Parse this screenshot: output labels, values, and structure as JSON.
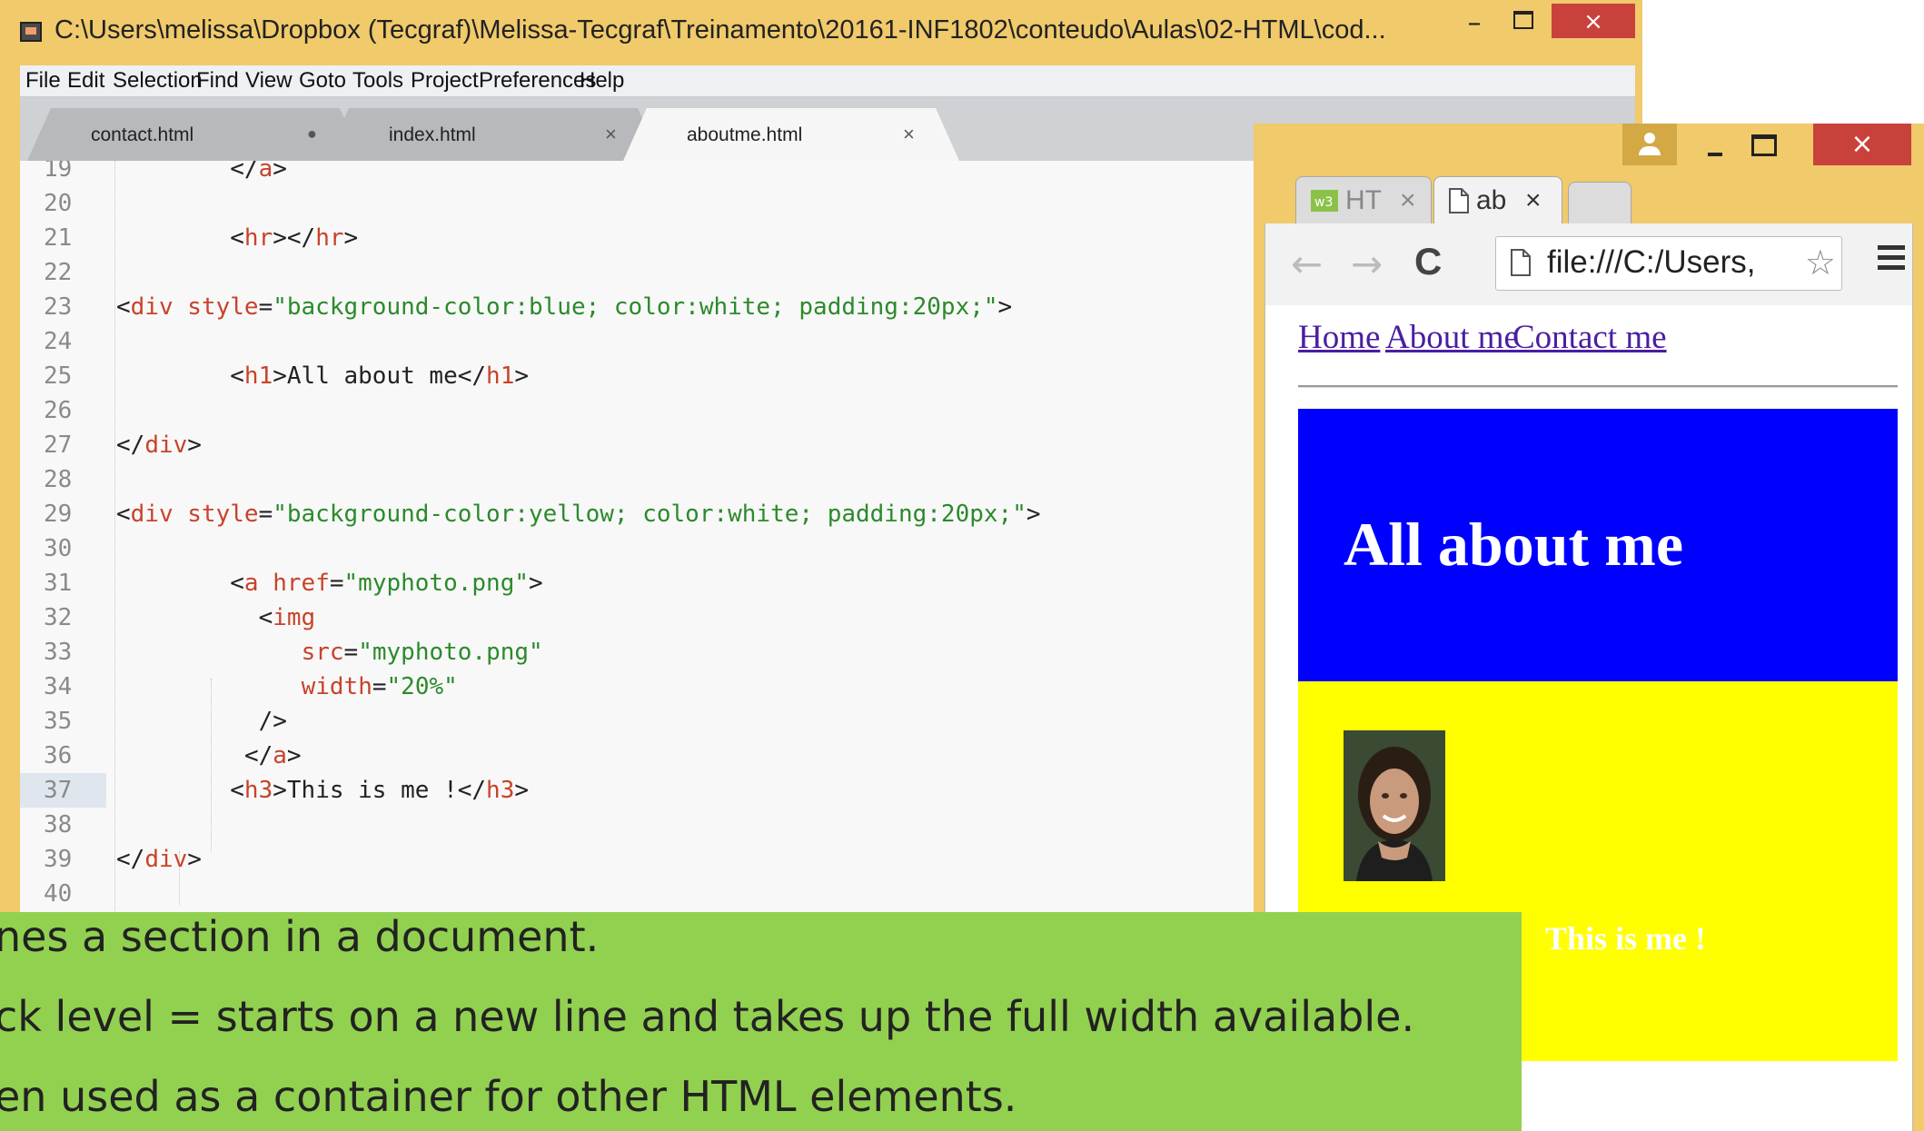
{
  "editor": {
    "title": "C:\\Users\\melissa\\Dropbox (Tecgraf)\\Melissa-Tecgraf\\Treinamento\\20161-INF1802\\conteudo\\Aulas\\02-HTML\\cod...",
    "window_controls": {
      "minimize": "–",
      "close": "×"
    },
    "menu": [
      "File",
      "Edit",
      "Selection",
      "Find",
      "View",
      "Goto",
      "Tools",
      "Project",
      "Preferences",
      "Help"
    ],
    "tabs": [
      {
        "label": "contact.html",
        "marker": "●"
      },
      {
        "label": "index.html",
        "marker": "×"
      },
      {
        "label": "aboutme.html",
        "marker": "×",
        "active": true
      }
    ],
    "current_line": "37",
    "lines": [
      {
        "n": "19",
        "indent": 8,
        "parts": [
          [
            "p",
            "</"
          ],
          [
            "t",
            "a"
          ],
          [
            "p",
            ">"
          ]
        ]
      },
      {
        "n": "20",
        "indent": 0,
        "parts": []
      },
      {
        "n": "21",
        "indent": 8,
        "parts": [
          [
            "p",
            "<"
          ],
          [
            "t",
            "hr"
          ],
          [
            "p",
            "></"
          ],
          [
            "t",
            "hr"
          ],
          [
            "p",
            ">"
          ]
        ]
      },
      {
        "n": "22",
        "indent": 0,
        "parts": []
      },
      {
        "n": "23",
        "indent": 0,
        "parts": [
          [
            "p",
            "<"
          ],
          [
            "t",
            "div"
          ],
          [
            "p",
            " "
          ],
          [
            "a",
            "style"
          ],
          [
            "p",
            "="
          ],
          [
            "s",
            "\"background-color:blue; color:white; padding:20px;\""
          ],
          [
            "p",
            ">"
          ]
        ]
      },
      {
        "n": "24",
        "indent": 0,
        "parts": []
      },
      {
        "n": "25",
        "indent": 8,
        "parts": [
          [
            "p",
            "<"
          ],
          [
            "t",
            "h1"
          ],
          [
            "p",
            ">All about me</"
          ],
          [
            "t",
            "h1"
          ],
          [
            "p",
            ">"
          ]
        ]
      },
      {
        "n": "26",
        "indent": 0,
        "parts": []
      },
      {
        "n": "27",
        "indent": 0,
        "parts": [
          [
            "p",
            "</"
          ],
          [
            "t",
            "div"
          ],
          [
            "p",
            ">"
          ]
        ]
      },
      {
        "n": "28",
        "indent": 0,
        "parts": []
      },
      {
        "n": "29",
        "indent": 0,
        "parts": [
          [
            "p",
            "<"
          ],
          [
            "t",
            "div"
          ],
          [
            "p",
            " "
          ],
          [
            "a",
            "style"
          ],
          [
            "p",
            "="
          ],
          [
            "s",
            "\"background-color:yellow; color:white; padding:20px;\""
          ],
          [
            "p",
            ">"
          ]
        ]
      },
      {
        "n": "30",
        "indent": 0,
        "parts": []
      },
      {
        "n": "31",
        "indent": 8,
        "parts": [
          [
            "p",
            "<"
          ],
          [
            "t",
            "a"
          ],
          [
            "p",
            " "
          ],
          [
            "a",
            "href"
          ],
          [
            "p",
            "="
          ],
          [
            "s",
            "\"myphoto.png\""
          ],
          [
            "p",
            ">"
          ]
        ]
      },
      {
        "n": "32",
        "indent": 10,
        "parts": [
          [
            "p",
            "<"
          ],
          [
            "t",
            "img"
          ]
        ]
      },
      {
        "n": "33",
        "indent": 13,
        "parts": [
          [
            "a",
            "src"
          ],
          [
            "p",
            "="
          ],
          [
            "s",
            "\"myphoto.png\""
          ]
        ]
      },
      {
        "n": "34",
        "indent": 13,
        "parts": [
          [
            "a",
            "width"
          ],
          [
            "p",
            "="
          ],
          [
            "s",
            "\"20%\""
          ]
        ]
      },
      {
        "n": "35",
        "indent": 10,
        "parts": [
          [
            "p",
            "/>"
          ]
        ]
      },
      {
        "n": "36",
        "indent": 9,
        "parts": [
          [
            "p",
            "</"
          ],
          [
            "t",
            "a"
          ],
          [
            "p",
            ">"
          ]
        ]
      },
      {
        "n": "37",
        "indent": 8,
        "parts": [
          [
            "p",
            "<"
          ],
          [
            "t",
            "h3"
          ],
          [
            "p",
            ">This is me !</"
          ],
          [
            "t",
            "h3"
          ],
          [
            "p",
            ">"
          ]
        ]
      },
      {
        "n": "38",
        "indent": 0,
        "parts": []
      },
      {
        "n": "39",
        "indent": 0,
        "parts": [
          [
            "p",
            "</"
          ],
          [
            "t",
            "div"
          ],
          [
            "p",
            ">"
          ]
        ]
      },
      {
        "n": "40",
        "indent": 0,
        "parts": []
      }
    ]
  },
  "browser": {
    "tabs": [
      {
        "icon": "w3",
        "label": "HT",
        "close": "×"
      },
      {
        "icon": "page",
        "label": "ab",
        "close": "×",
        "active": true
      }
    ],
    "window_controls": {
      "close": "×"
    },
    "nav": {
      "back": "←",
      "forward": "→",
      "reload": "C"
    },
    "url": "file:///C:/Users,",
    "page": {
      "links": [
        "Home",
        "About me",
        "Contact me"
      ],
      "heading": "All about me",
      "h3": "This is me !",
      "blue_bg": "#0000ff",
      "yellow_bg": "#ffff00"
    }
  },
  "caption": {
    "lines": [
      "nes a section in a document.",
      "ck level =  starts on a new line and takes up the full width available.",
      "en used as a container for other HTML elements."
    ],
    "background": "#92d050"
  },
  "colors": {
    "window_frame": "#f0ca6b",
    "close_button": "#c8423b",
    "code_tag": "#c8432a",
    "code_string": "#2c8a2c"
  }
}
